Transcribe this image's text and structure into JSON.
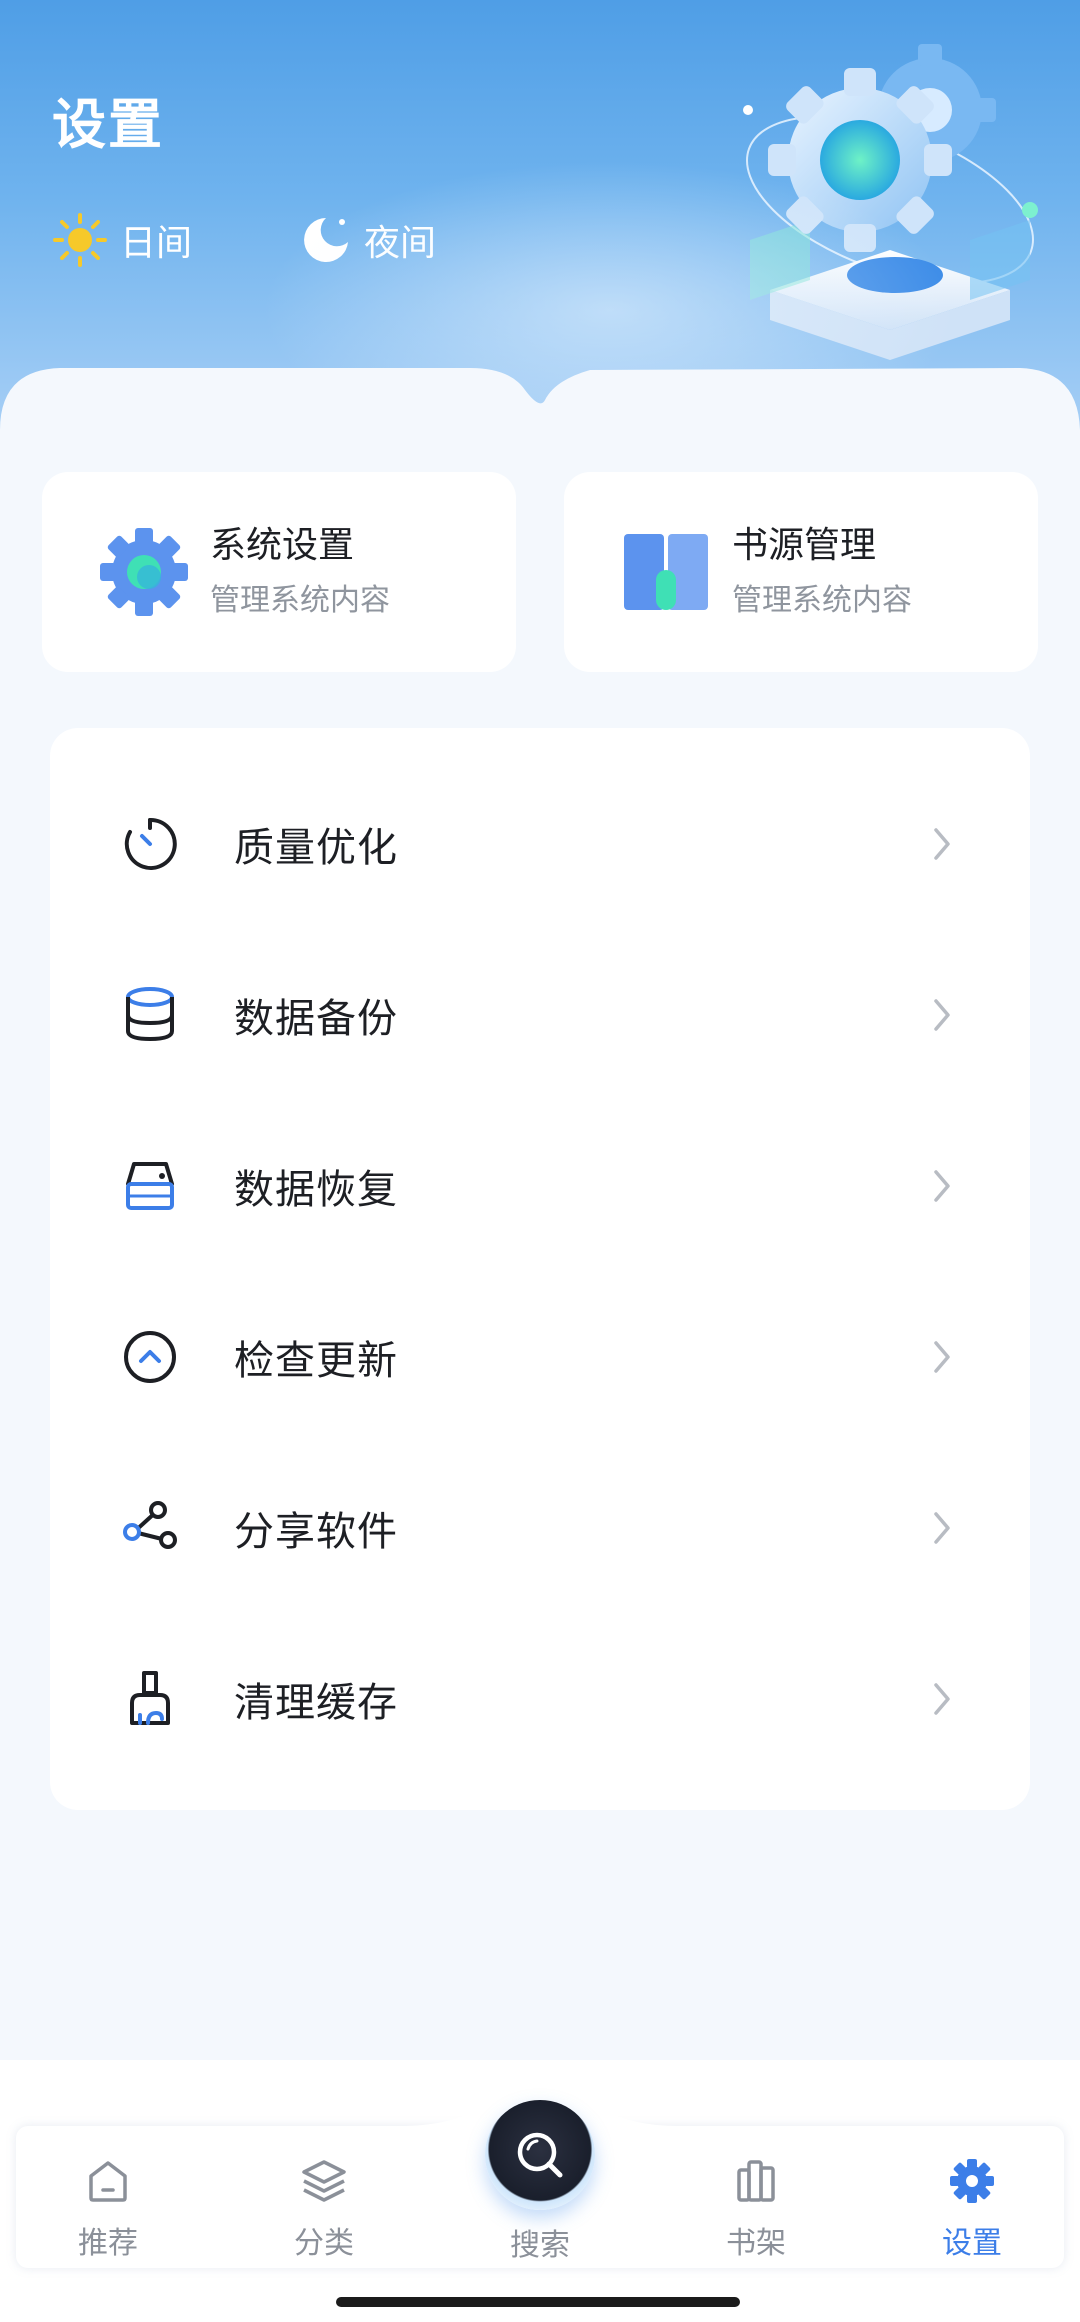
{
  "header": {
    "title": "设置",
    "day_mode_label": "日间",
    "night_mode_label": "夜间"
  },
  "quick_cards": [
    {
      "title": "系统设置",
      "subtitle": "管理系统内容",
      "icon": "gear-icon"
    },
    {
      "title": "书源管理",
      "subtitle": "管理系统内容",
      "icon": "book-icon"
    }
  ],
  "menu": {
    "items": [
      {
        "label": "质量优化",
        "icon": "timer-icon"
      },
      {
        "label": "数据备份",
        "icon": "database-icon"
      },
      {
        "label": "数据恢复",
        "icon": "drive-icon"
      },
      {
        "label": "检查更新",
        "icon": "update-icon"
      },
      {
        "label": "分享软件",
        "icon": "share-icon"
      },
      {
        "label": "清理缓存",
        "icon": "brush-icon"
      }
    ]
  },
  "bottom_nav": {
    "items": [
      {
        "label": "推荐",
        "icon": "home-icon"
      },
      {
        "label": "分类",
        "icon": "layers-icon"
      },
      {
        "label": "搜索",
        "icon": "search-icon"
      },
      {
        "label": "书架",
        "icon": "bookshelf-icon"
      },
      {
        "label": "设置",
        "icon": "settings-icon"
      }
    ],
    "active": "设置"
  },
  "colors": {
    "accent": "#3c7ee8",
    "header_top": "#4f9ee6",
    "background": "#f4f8fd",
    "text_primary": "#1d1f24",
    "text_secondary": "#8f959e"
  }
}
